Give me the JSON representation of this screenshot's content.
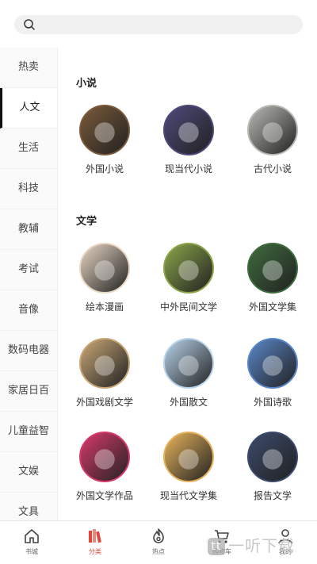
{
  "search": {
    "placeholder": ""
  },
  "sidebar": {
    "items": [
      {
        "label": "热卖"
      },
      {
        "label": "人文",
        "active": true
      },
      {
        "label": "生活"
      },
      {
        "label": "科技"
      },
      {
        "label": "教辅"
      },
      {
        "label": "考试"
      },
      {
        "label": "音像"
      },
      {
        "label": "数码电器"
      },
      {
        "label": "家居日百"
      },
      {
        "label": "儿童益智"
      },
      {
        "label": "文娱"
      },
      {
        "label": "文具"
      }
    ]
  },
  "sections": [
    {
      "title": "小说",
      "tiles": [
        {
          "label": "外国小说",
          "color": "#7a5a3a"
        },
        {
          "label": "现当代小说",
          "color": "#4d4a7a"
        },
        {
          "label": "古代小说",
          "color": "#b9b9b4"
        }
      ]
    },
    {
      "title": "文学",
      "tiles": [
        {
          "label": "绘本漫画",
          "color": "#e8d7c4"
        },
        {
          "label": "中外民间文学",
          "color": "#8aa54a"
        },
        {
          "label": "外国文学集",
          "color": "#3e6b3c"
        },
        {
          "label": "外国戏剧文学",
          "color": "#c9a776"
        },
        {
          "label": "外国散文",
          "color": "#b8d3ea"
        },
        {
          "label": "外国诗歌",
          "color": "#5a86c8"
        },
        {
          "label": "外国文学作品",
          "color": "#d63a6b"
        },
        {
          "label": "现当代文学集",
          "color": "#e6b25c"
        },
        {
          "label": "报告文学",
          "color": "#3b4a6b"
        }
      ]
    }
  ],
  "tabbar": {
    "items": [
      {
        "label": "书城",
        "icon": "home-icon"
      },
      {
        "label": "分类",
        "icon": "books-icon",
        "active": true
      },
      {
        "label": "热点",
        "icon": "flame-icon"
      },
      {
        "label": "购物车",
        "icon": "cart-icon"
      },
      {
        "label": "我的",
        "icon": "person-icon"
      }
    ],
    "accent": "#e0483c"
  },
  "watermark": {
    "text": "一听下载",
    "badge": "tt"
  }
}
